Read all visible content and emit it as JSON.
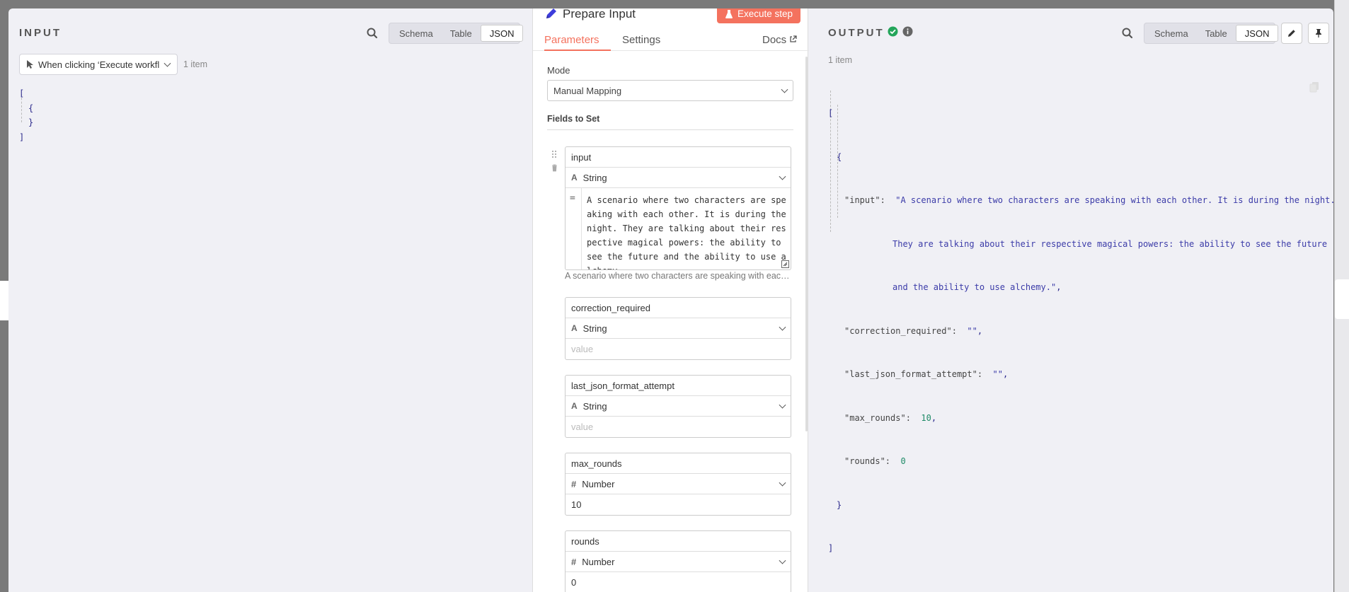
{
  "input_panel": {
    "title": "INPUT",
    "views": [
      "Schema",
      "Table",
      "JSON"
    ],
    "active_view": "JSON",
    "trigger_select": "When clicking ‘Execute workfl",
    "item_count": "1 item",
    "json_lines": [
      "[",
      "{",
      "}",
      "]"
    ]
  },
  "node": {
    "title": "Prepare Input",
    "execute_label": "Execute step",
    "tabs": {
      "parameters": "Parameters",
      "settings": "Settings",
      "docs": "Docs"
    },
    "mode_label": "Mode",
    "mode_value": "Manual Mapping",
    "fields_label": "Fields to Set",
    "fields": [
      {
        "name": "input",
        "type": "String",
        "value": "A scenario where two characters are speaking with each other. It is during the night. They are talking about their respective magical powers: the ability to see the future and the ability to use alchemy.",
        "hint": "A scenario where two characters are speaking with each other. It is during the night."
      },
      {
        "name": "correction_required",
        "type": "String",
        "placeholder": "value"
      },
      {
        "name": "last_json_format_attempt",
        "type": "String",
        "placeholder": "value"
      },
      {
        "name": "max_rounds",
        "type": "Number",
        "value": "10"
      },
      {
        "name": "rounds",
        "type": "Number",
        "value": "0"
      }
    ]
  },
  "output_panel": {
    "title": "OUTPUT",
    "views": [
      "Schema",
      "Table",
      "JSON"
    ],
    "active_view": "JSON",
    "item_count": "1 item",
    "json": {
      "open_bracket": "[",
      "open_brace": "{",
      "input_key": "\"input\":",
      "input_line1": "\"A scenario where two characters are speaking with each other. It is during the night.",
      "input_line2": "They are talking about their respective magical powers: the ability to see the future",
      "input_line3": "and the ability to use alchemy.\"",
      "correction_key": "\"correction_required\":",
      "correction_val": "\"\"",
      "last_key": "\"last_json_format_attempt\":",
      "last_val": "\"\"",
      "max_key": "\"max_rounds\":",
      "max_val": "10",
      "rounds_key": "\"rounds\":",
      "rounds_val": "0",
      "close_brace": "}",
      "close_bracket": "]"
    }
  },
  "colors": {
    "accent": "#f4725e",
    "success": "#23a55a",
    "link": "#2c2a8c"
  }
}
